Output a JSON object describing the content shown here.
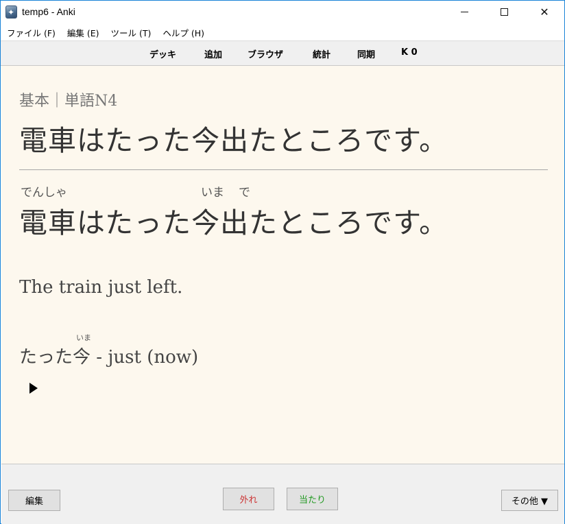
{
  "window": {
    "title": "temp6 - Anki",
    "minimize_label": "—",
    "close_label": "✕"
  },
  "menu": {
    "items": [
      "ファイル (F)",
      "編集 (E)",
      "ツール (T)",
      "ヘルプ (H)"
    ]
  },
  "toolbar": {
    "deck": "デッキ",
    "add": "追加",
    "browse": "ブラウザ",
    "stats": "統計",
    "sync": "同期",
    "count": "K 0"
  },
  "card": {
    "deck_label": "基本｜単語N4",
    "front_sentence": "電車はたった今出たところです。",
    "answer_sentence": "電車はたった今出たところです。",
    "furigana": {
      "densha": "でんしゃ",
      "ima": "いま",
      "de": "で"
    },
    "meaning": "The train just left.",
    "vocab_word": "たった今",
    "vocab_gloss": " - just (now)",
    "vocab_furigana": "いま"
  },
  "buttons": {
    "edit": "編集",
    "again": "外れ",
    "good": "当たり",
    "more": "その他 ▼"
  },
  "colors": {
    "card_background": "#fdf8ee",
    "again_text": "#cc3333",
    "good_text": "#229922",
    "window_border": "#1883d7"
  }
}
